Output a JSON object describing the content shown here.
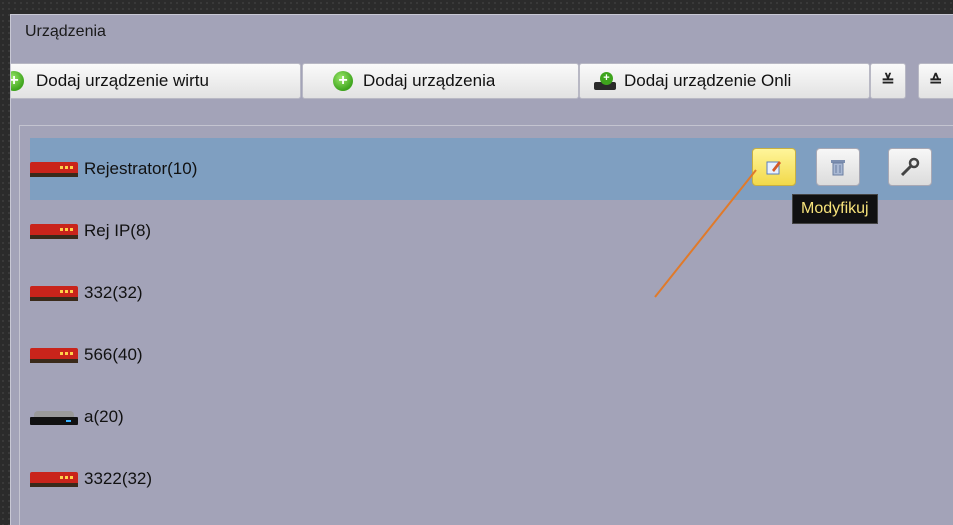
{
  "panel": {
    "title": "Urządzenia"
  },
  "toolbar": {
    "add_virtual": "Dodaj urządzenie wirtu",
    "add_devices": "Dodaj urządzenia",
    "add_online": "Dodaj urządzenie Onli",
    "collapse_glyph": "≚",
    "expand_glyph": "≙"
  },
  "devices": [
    {
      "label": "Rejestrator(10)",
      "icon": "dvr-icon",
      "selected": true
    },
    {
      "label": "Rej IP(8)",
      "icon": "dvr-icon"
    },
    {
      "label": "332(32)",
      "icon": "dvr-icon"
    },
    {
      "label": "566(40)",
      "icon": "dvr-icon"
    },
    {
      "label": "a(20)",
      "icon": "nvr-icon"
    },
    {
      "label": "3322(32)",
      "icon": "dvr-icon"
    }
  ],
  "row_actions": {
    "edit_icon": "edit-icon",
    "delete_icon": "trash-icon",
    "settings_icon": "wrench-icon"
  },
  "tooltip": {
    "text": "Modyfikuj"
  },
  "colors": {
    "selection": "#7f9fc1",
    "panel": "#a3a3b8",
    "tooltip_text": "#f6e27a",
    "annotation_arrow": "#e07a2a"
  }
}
